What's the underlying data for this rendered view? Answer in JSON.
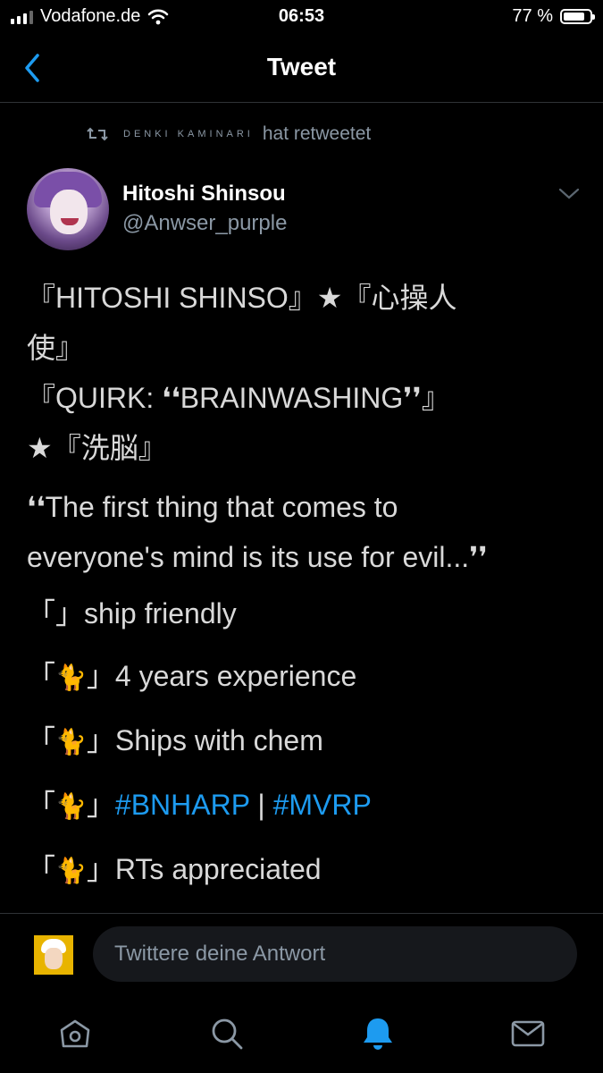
{
  "status": {
    "carrier": "Vodafone.de",
    "time": "06:53",
    "battery": "77 %",
    "battery_level": 0.77
  },
  "header": {
    "title": "Tweet",
    "back_icon": "chevron-left-icon"
  },
  "retweet": {
    "name": "DENKI KAMINARI",
    "text": "hat retweetet",
    "icon": "retweet-icon"
  },
  "tweet": {
    "display_name": "Hitoshi Shinsou",
    "handle": "@Anwser_purple",
    "lines": {
      "l1": "『HITOSHI SHINSO』★『心操人",
      "l2": "使』",
      "l3": "『QUIRK: ❛❛BRAINWASHING❜❜』",
      "l4": "★『洗脳』",
      "quote1": "❛❛The first thing that comes to",
      "quote2": "everyone's mind is its use for evil...❜❜",
      "item1": "「」ship friendly",
      "item2_prefix": "「",
      "item2_cat": "🐈",
      "item2_suffix": "」4 years experience",
      "item3_prefix": "「",
      "item3_cat": "🐈",
      "item3_suffix": "」Ships with chem",
      "item4_prefix": "「",
      "item4_cat": "🐈",
      "item4_mid": "」",
      "hashtag1": "#BNHARP",
      "sep": " | ",
      "hashtag2": "#MVRP",
      "item5_prefix": "「",
      "item5_cat": "🐈",
      "item5_suffix": "」RTs appreciated"
    }
  },
  "reply": {
    "placeholder": "Twittere deine Antwort"
  },
  "tabs": {
    "home": "home-icon",
    "search": "search-icon",
    "notifications": "bell-icon",
    "messages": "mail-icon",
    "active_color": "#1d9bf0",
    "inactive_color": "#8b98a5"
  }
}
